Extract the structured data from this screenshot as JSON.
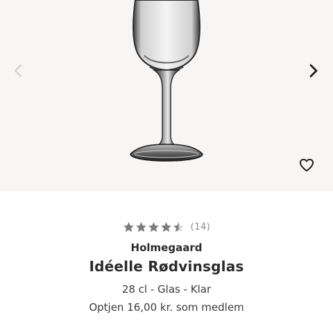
{
  "gallery": {
    "prev_icon": "chevron-left-icon",
    "next_icon": "chevron-right-icon",
    "favorite_icon": "heart-outline-icon",
    "background_color": "#f8f6f4"
  },
  "product": {
    "rating": 4.5,
    "rating_max": 5,
    "review_count": "(14)",
    "brand": "Holmegaard",
    "title": "Idéelle Rødvinsglas",
    "specs": "28 cl - Glas - Klar",
    "member_earn": "Optjen 16,00 kr. som medlem"
  },
  "colors": {
    "star_filled": "#7d7d7d",
    "star_empty": "#d8d8d8",
    "text": "#2b2b2b"
  }
}
